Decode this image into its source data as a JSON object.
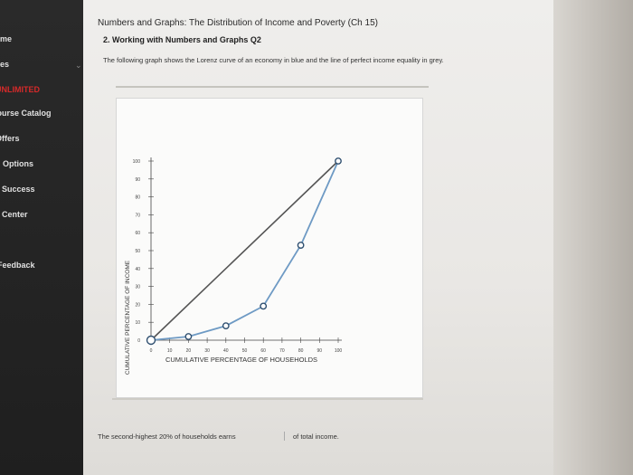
{
  "sidebar": {
    "items": [
      {
        "label": "Home"
      },
      {
        "label": "Courses"
      },
      {
        "label": "UNLIMITED"
      },
      {
        "label": "Course Catalog"
      },
      {
        "label": "Offers"
      },
      {
        "label": "Options"
      },
      {
        "label": "Success"
      },
      {
        "label": "Center"
      },
      {
        "label": "Feedback"
      }
    ]
  },
  "header": {
    "title": "Numbers and Graphs: The Distribution of Income and Poverty (Ch 15)",
    "subtitle": "2. Working with Numbers and Graphs Q2"
  },
  "question": {
    "prompt": "The following graph shows the Lorenz curve of an economy in blue and the line of perfect income equality in grey.",
    "fill_in_before": "The second-highest 20% of households earns",
    "fill_in_after": "of total income."
  },
  "help": {
    "label": "?"
  },
  "colors": {
    "lorenz": "#6e9ac4",
    "equality": "#555555",
    "point_fill": "#ffffff",
    "point_stroke": "#2f4f6f"
  },
  "chart_data": {
    "type": "line",
    "xlabel": "CUMULATIVE PERCENTAGE OF HOUSEHOLDS",
    "ylabel": "CUMULATIVE PERCENTAGE OF INCOME",
    "xlim": [
      0,
      100
    ],
    "ylim": [
      0,
      100
    ],
    "xticks": [
      "0",
      "10",
      "20",
      "30",
      "40",
      "50",
      "60",
      "70",
      "80",
      "90",
      "100"
    ],
    "yticks": [
      "0",
      "10",
      "20",
      "30",
      "40",
      "50",
      "60",
      "70",
      "80",
      "90",
      "100"
    ],
    "series": [
      {
        "x": [
          0,
          20,
          40,
          60,
          80,
          100
        ],
        "y": [
          0,
          2,
          8,
          19,
          53,
          100
        ]
      },
      {
        "x": [
          0,
          100
        ],
        "y": [
          0,
          100
        ]
      }
    ]
  }
}
